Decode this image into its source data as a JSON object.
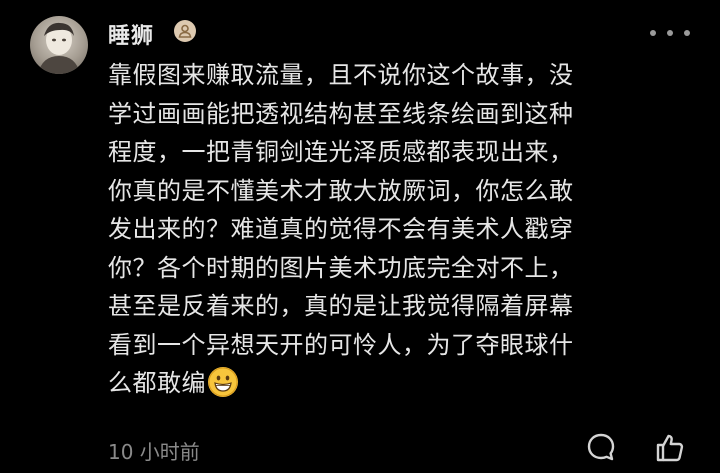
{
  "comment": {
    "username": "睡狮",
    "badge_icon": "user-badge-icon",
    "more_icon": "more-dots-icon",
    "lines": [
      "靠假图来赚取流量，且不说你这个故事，没",
      "学过画画能把透视结构甚至线条绘画到这种",
      "程度，一把青铜剑连光泽质感都表现出来，",
      "你真的是不懂美术才敢大放厥词，你怎么敢",
      "发出来的？难道真的觉得不会有美术人戳穿",
      "你？各个时期的图片美术功底完全对不上，",
      "甚至是反着来的，真的是让我觉得隔着屏幕",
      "看到一个异想天开的可怜人，为了夺眼球什",
      "么都敢编"
    ],
    "emoji_icon": "grinning-face-emoji",
    "timestamp": "10 小时前",
    "reply_icon": "comment-bubble-icon",
    "like_icon": "thumbs-up-icon"
  },
  "colors": {
    "background": "#000000",
    "text": "#e6e6e6",
    "muted": "#8a8a8a",
    "badge": "#ddc9b0"
  }
}
